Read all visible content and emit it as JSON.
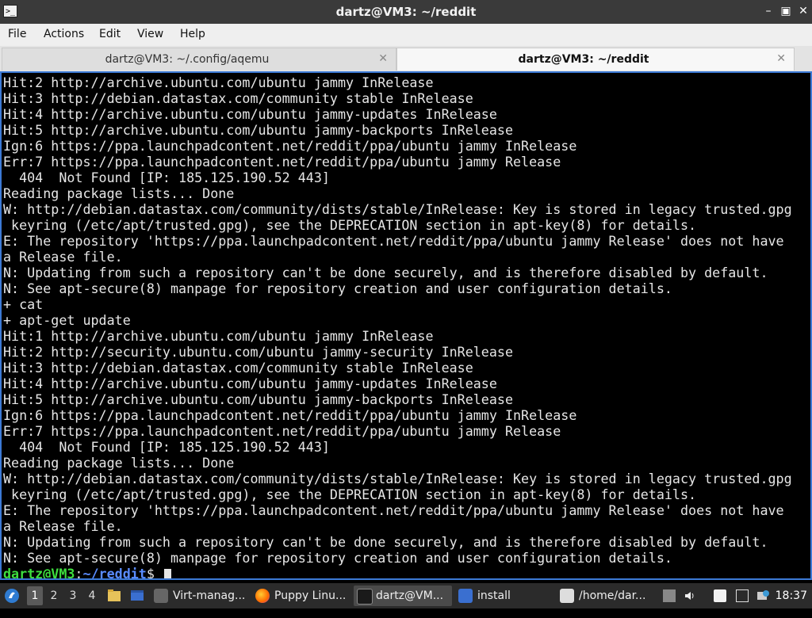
{
  "window": {
    "title": "dartz@VM3: ~/reddit"
  },
  "menu": [
    "File",
    "Actions",
    "Edit",
    "View",
    "Help"
  ],
  "tabs": [
    {
      "label": "dartz@VM3: ~/.config/aqemu",
      "active": false
    },
    {
      "label": "dartz@VM3: ~/reddit",
      "active": true
    }
  ],
  "terminal": {
    "lines": [
      "Hit:2 http://archive.ubuntu.com/ubuntu jammy InRelease",
      "Hit:3 http://debian.datastax.com/community stable InRelease",
      "Hit:4 http://archive.ubuntu.com/ubuntu jammy-updates InRelease",
      "Hit:5 http://archive.ubuntu.com/ubuntu jammy-backports InRelease",
      "Ign:6 https://ppa.launchpadcontent.net/reddit/ppa/ubuntu jammy InRelease",
      "Err:7 https://ppa.launchpadcontent.net/reddit/ppa/ubuntu jammy Release",
      "  404  Not Found [IP: 185.125.190.52 443]",
      "Reading package lists... Done",
      "W: http://debian.datastax.com/community/dists/stable/InRelease: Key is stored in legacy trusted.gpg",
      " keyring (/etc/apt/trusted.gpg), see the DEPRECATION section in apt-key(8) for details.",
      "E: The repository 'https://ppa.launchpadcontent.net/reddit/ppa/ubuntu jammy Release' does not have",
      "a Release file.",
      "N: Updating from such a repository can't be done securely, and is therefore disabled by default.",
      "N: See apt-secure(8) manpage for repository creation and user configuration details.",
      "+ cat",
      "+ apt-get update",
      "Hit:1 http://archive.ubuntu.com/ubuntu jammy InRelease",
      "Hit:2 http://security.ubuntu.com/ubuntu jammy-security InRelease",
      "Hit:3 http://debian.datastax.com/community stable InRelease",
      "Hit:4 http://archive.ubuntu.com/ubuntu jammy-updates InRelease",
      "Hit:5 http://archive.ubuntu.com/ubuntu jammy-backports InRelease",
      "Ign:6 https://ppa.launchpadcontent.net/reddit/ppa/ubuntu jammy InRelease",
      "Err:7 https://ppa.launchpadcontent.net/reddit/ppa/ubuntu jammy Release",
      "  404  Not Found [IP: 185.125.190.52 443]",
      "Reading package lists... Done",
      "W: http://debian.datastax.com/community/dists/stable/InRelease: Key is stored in legacy trusted.gpg",
      " keyring (/etc/apt/trusted.gpg), see the DEPRECATION section in apt-key(8) for details.",
      "E: The repository 'https://ppa.launchpadcontent.net/reddit/ppa/ubuntu jammy Release' does not have",
      "a Release file.",
      "N: Updating from such a repository can't be done securely, and is therefore disabled by default.",
      "N: See apt-secure(8) manpage for repository creation and user configuration details."
    ],
    "prompt": {
      "user_host": "dartz@VM3",
      "sep": ":",
      "path": "~/reddit",
      "symbol": "$ "
    }
  },
  "taskbar": {
    "workspaces": [
      "1",
      "2",
      "3",
      "4"
    ],
    "tasks": [
      {
        "label": "Virt-manag...",
        "icon": "virt-manager-icon"
      },
      {
        "label": "Puppy Linu...",
        "icon": "firefox-icon"
      },
      {
        "label": "dartz@VM...",
        "icon": "terminal-icon"
      },
      {
        "label": "install",
        "icon": "folder-icon"
      },
      {
        "label": "/home/dar...",
        "icon": "text-editor-icon"
      }
    ],
    "clock": "18:37"
  },
  "colors": {
    "accent": "#3c7ad6",
    "prompt_user": "#3ede3e",
    "prompt_path": "#5a8cff"
  }
}
